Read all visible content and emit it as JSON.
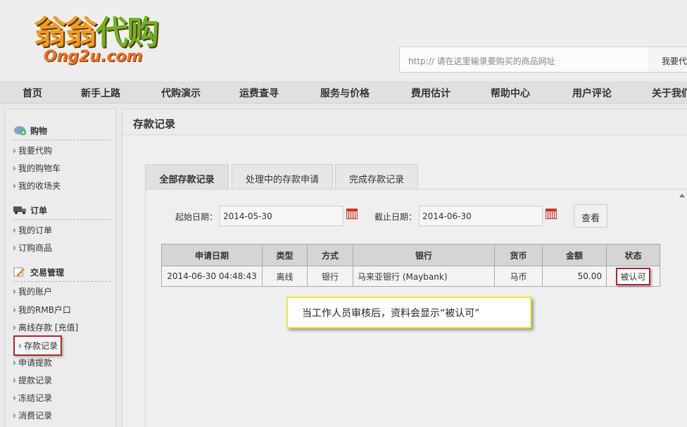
{
  "brand": {
    "logo_cn_a": "翁翁",
    "logo_cn_b": "代购",
    "logo_en": "Ong2u.com"
  },
  "search": {
    "placeholder": "http:// 请在这里输录要购买的商品网址",
    "button_label": "我要代购"
  },
  "nav": {
    "items": [
      "首页",
      "新手上路",
      "代购演示",
      "运费查寻",
      "服务与价格",
      "费用估计",
      "帮助中心",
      "用户评论",
      "关于我们"
    ]
  },
  "sidebar": {
    "sections": [
      {
        "title": "购物",
        "icon": "cart-icon",
        "items": [
          "我要代购",
          "我的购物车",
          "我的收场夹"
        ]
      },
      {
        "title": "订单",
        "icon": "truck-icon",
        "items": [
          "我的订单",
          "订购商品"
        ]
      },
      {
        "title": "交易管理",
        "icon": "edit-icon",
        "items": [
          "我的账户",
          "我的RMB户口",
          "离线存款 [充值]",
          "存款记录",
          "申请提款",
          "提款记录",
          "冻结记录",
          "消费记录"
        ]
      }
    ],
    "active_item": "存款记录"
  },
  "main": {
    "title": "存款记录",
    "tabs": [
      "全部存款记录",
      "处理中的存款申请",
      "完成存款记录"
    ],
    "active_tab": "全部存款记录"
  },
  "filter": {
    "start_label": "起始日期：",
    "start_value": "2014-05-30",
    "end_label": "截止日期：",
    "end_value": "2014-06-30",
    "query_button": "查看"
  },
  "table": {
    "headers": [
      "申请日期",
      "类型",
      "方式",
      "银行",
      "货币",
      "金额",
      "状态"
    ],
    "rows": [
      {
        "date": "2014-06-30 04:48:43",
        "type": "离线",
        "method": "银行",
        "bank": "马来亚银行 (Maybank)",
        "currency": "马币",
        "amount": "50.00",
        "status": "被认可"
      }
    ]
  },
  "callout": {
    "text": "当工作人员审核后，资料会显示“被认可”"
  },
  "colors": {
    "highlight_border": "#b0272b",
    "callout_border": "#ecec2e",
    "logo_orange": "#f39a1f",
    "logo_green": "#6fb325"
  }
}
